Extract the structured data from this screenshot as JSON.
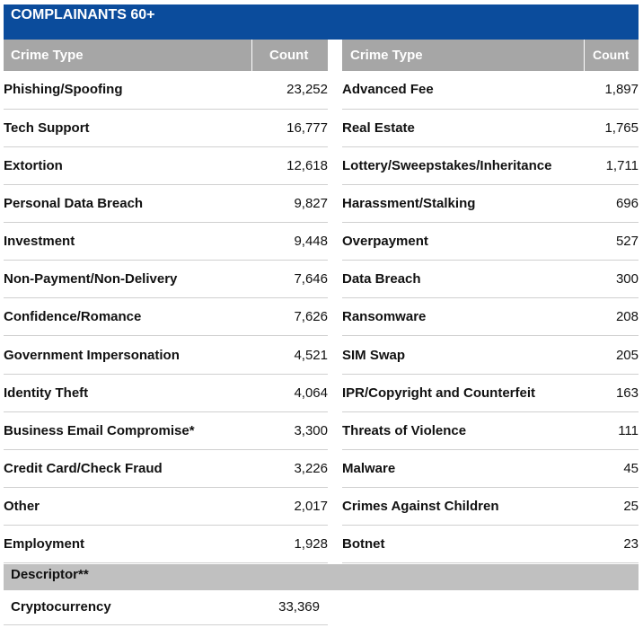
{
  "title": "COMPLAINANTS 60+",
  "headers": {
    "left_crime": "Crime Type",
    "left_count": "Count",
    "right_crime": "Crime Type",
    "right_count": "Count"
  },
  "rows": [
    {
      "left_name": "Phishing/Spoofing",
      "left_count": "23,252",
      "right_name": "Advanced Fee",
      "right_count": "1,897"
    },
    {
      "left_name": "Tech Support",
      "left_count": "16,777",
      "right_name": "Real Estate",
      "right_count": "1,765"
    },
    {
      "left_name": "Extortion",
      "left_count": "12,618",
      "right_name": "Lottery/Sweepstakes/Inheritance",
      "right_count": "1,711"
    },
    {
      "left_name": "Personal Data Breach",
      "left_count": "9,827",
      "right_name": "Harassment/Stalking",
      "right_count": "696"
    },
    {
      "left_name": "Investment",
      "left_count": "9,448",
      "right_name": "Overpayment",
      "right_count": "527"
    },
    {
      "left_name": "Non-Payment/Non-Delivery",
      "left_count": "7,646",
      "right_name": "Data Breach",
      "right_count": "300"
    },
    {
      "left_name": "Confidence/Romance",
      "left_count": "7,626",
      "right_name": "Ransomware",
      "right_count": "208"
    },
    {
      "left_name": "Government Impersonation",
      "left_count": "4,521",
      "right_name": "SIM Swap",
      "right_count": "205"
    },
    {
      "left_name": "Identity Theft",
      "left_count": "4,064",
      "right_name": "IPR/Copyright and Counterfeit",
      "right_count": "163"
    },
    {
      "left_name": "Business Email Compromise*",
      "left_count": "3,300",
      "right_name": "Threats of Violence",
      "right_count": "111"
    },
    {
      "left_name": "Credit Card/Check Fraud",
      "left_count": "3,226",
      "right_name": "Malware",
      "right_count": "45"
    },
    {
      "left_name": "Other",
      "left_count": "2,017",
      "right_name": "Crimes Against Children",
      "right_count": "25"
    },
    {
      "left_name": "Employment",
      "left_count": "1,928",
      "right_name": "Botnet",
      "right_count": "23"
    }
  ],
  "descriptor": {
    "label": "Descriptor**",
    "name": "Cryptocurrency",
    "count": "33,369"
  },
  "colors": {
    "title_bg": "#0b4c9c",
    "header_bg": "#a6a6a6",
    "descriptor_bg": "#c0c0c0"
  }
}
